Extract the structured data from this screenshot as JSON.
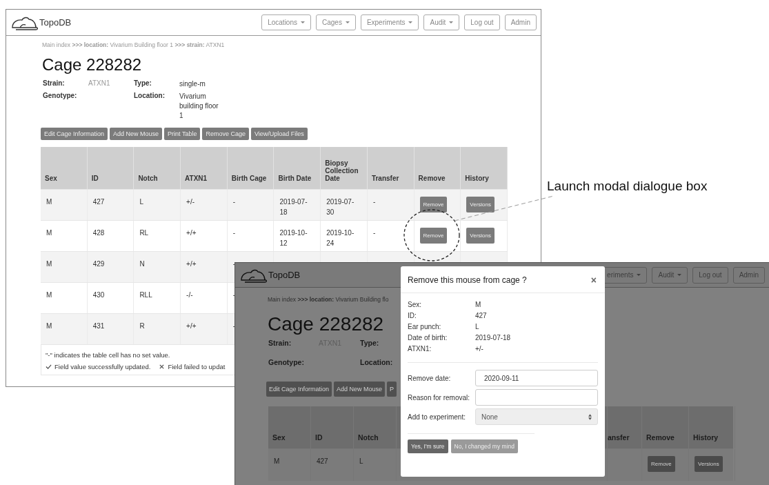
{
  "main_window": {
    "brand": "TopoDB",
    "nav": [
      {
        "label": "Locations",
        "dropdown": true
      },
      {
        "label": "Cages",
        "dropdown": true
      },
      {
        "label": "Experiments",
        "dropdown": true
      },
      {
        "label": "Audit",
        "dropdown": true
      },
      {
        "label": "Log out",
        "dropdown": false
      },
      {
        "label": "Admin",
        "dropdown": false
      }
    ],
    "breadcrumb": "Main index **>>> location:** Vivarium Building floor 1 **>>> strain:** ATXN1",
    "title": "Cage 228282",
    "details": [
      {
        "label": "Strain:",
        "value": "ATXN1",
        "kind": "link"
      },
      {
        "label": "Type:",
        "value": "single-m",
        "kind": "text"
      },
      {
        "label": "Genotype:"
      },
      {
        "label": "Location:",
        "value": "Vivarium building floor 1",
        "kind": "text"
      }
    ],
    "actions": [
      "Edit Cage Information",
      "Add New Mouse",
      "Print Table",
      "Remove Cage",
      "View/Upload Files"
    ],
    "table": {
      "columns": [
        "Sex",
        "ID",
        "Notch",
        "ATXN1",
        "Birth Cage",
        "Birth Date",
        "Biopsy Collection Date",
        "Transfer",
        "Remove",
        "History"
      ],
      "rows": [
        {
          "cells": [
            "M",
            "427",
            "L",
            "+/-",
            "-",
            "2019-07-18",
            "2019-07-30",
            "-"
          ],
          "remove": "Remove",
          "history": "Versions"
        },
        {
          "cells": [
            "M",
            "428",
            "RL",
            "+/+",
            "-",
            "2019-10-12",
            "2019-10-24",
            "-"
          ],
          "remove": "Remove",
          "history": "Versions"
        },
        {
          "cells": [
            "M",
            "429",
            "N",
            "+/+",
            "-"
          ]
        },
        {
          "cells": [
            "M",
            "430",
            "RLL",
            "-/-",
            "-"
          ]
        },
        {
          "cells": [
            "M",
            "431",
            "R",
            "+/+",
            "-"
          ]
        }
      ]
    },
    "footnote": "\"-\" indicates the table cell has no set value.",
    "legend": [
      {
        "kind": "success",
        "text": "Field value successfully updated."
      },
      {
        "kind": "failure",
        "text": "Field failed to updat"
      }
    ]
  },
  "modal_window": {
    "brand": "TopoDB",
    "nav": [
      {
        "label": "eriments",
        "dropdown": true
      },
      {
        "label": "Audit",
        "dropdown": true
      },
      {
        "label": "Log out",
        "dropdown": false
      },
      {
        "label": "Admin",
        "dropdown": false
      }
    ],
    "breadcrumb": "Main index **>>> location:** Vivarium Building flo",
    "title": "Cage 228282",
    "details": [
      {
        "label": "Strain:",
        "value": "ATXN1",
        "kind": "link"
      },
      {
        "label": "Type:"
      },
      {
        "label": "Genotype:"
      },
      {
        "label": "Location:"
      }
    ],
    "actions": [
      "Edit Cage Information",
      "Add New Mouse",
      "P"
    ],
    "table": {
      "columns": [
        "Sex",
        "ID",
        "Notch",
        "ansfer",
        "Remove",
        "History"
      ],
      "rows": [
        {
          "cells": [
            "M",
            "427",
            "L"
          ],
          "remove": "Remove",
          "history": "Versions"
        }
      ]
    },
    "dialog": {
      "title": "Remove this mouse from cage ?",
      "close": "×",
      "info": [
        {
          "label": "Sex:",
          "value": "M"
        },
        {
          "label": "ID:",
          "value": "427"
        },
        {
          "label": "Ear punch:",
          "value": "L"
        },
        {
          "label": "Date of birth:",
          "value": "2019-07-18"
        },
        {
          "label": "ATXN1:",
          "value": "+/-"
        }
      ],
      "fields": [
        {
          "kind": "input",
          "label": "Remove date:",
          "value": "2020-09-11"
        },
        {
          "kind": "input",
          "label": "Reason for removal:"
        },
        {
          "kind": "select",
          "label": "Add to experiment:",
          "value": "None"
        }
      ],
      "buttons": [
        {
          "label": "Yes, I'm sure",
          "kind": "primary"
        },
        {
          "label": "No, I changed my mind",
          "kind": "secondary"
        }
      ]
    }
  },
  "annotation": {
    "text": "Launch modal dialogue box"
  }
}
